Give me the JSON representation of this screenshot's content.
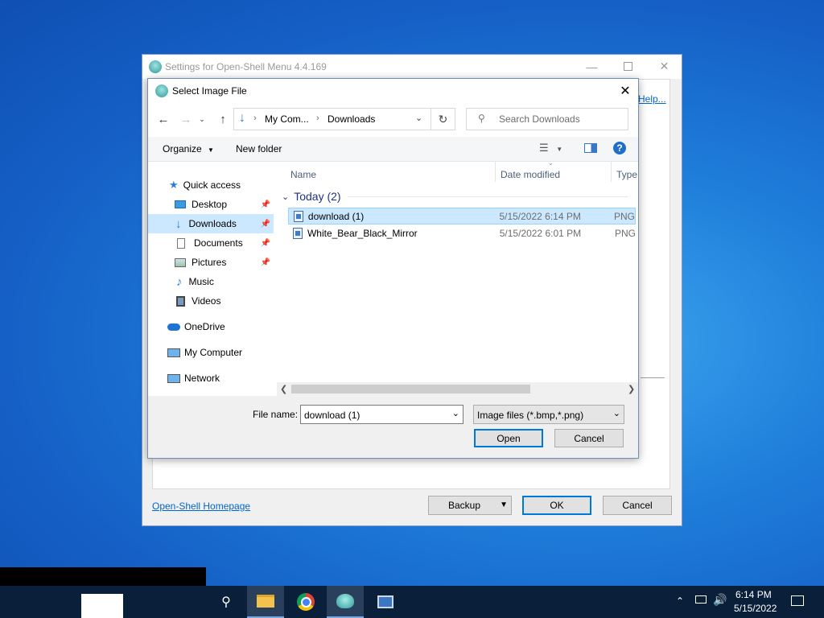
{
  "settings_window": {
    "title": "Settings for Open-Shell Menu 4.4.169",
    "help_link": "Help...",
    "homepage_link": "Open-Shell Homepage",
    "backup_label": "Backup",
    "ok_label": "OK",
    "cancel_label": "Cancel"
  },
  "dialog": {
    "title": "Select Image File",
    "breadcrumb": [
      "My Com...",
      "Downloads"
    ],
    "search_placeholder": "Search Downloads",
    "organize_label": "Organize",
    "new_folder_label": "New folder",
    "nav": {
      "quick_access": "Quick access",
      "desktop": "Desktop",
      "downloads": "Downloads",
      "documents": "Documents",
      "pictures": "Pictures",
      "music": "Music",
      "videos": "Videos",
      "onedrive": "OneDrive",
      "my_computer": "My Computer",
      "network": "Network"
    },
    "columns": {
      "name": "Name",
      "date": "Date modified",
      "type": "Type"
    },
    "group_label": "Today (2)",
    "files": [
      {
        "name": "download (1)",
        "date": "5/15/2022 6:14 PM",
        "type": "PNG"
      },
      {
        "name": "White_Bear_Black_Mirror",
        "date": "5/15/2022 6:01 PM",
        "type": "PNG"
      }
    ],
    "filename_label": "File name:",
    "filename_value": "download (1)",
    "filter_value": "Image files (*.bmp,*.png)",
    "open_label": "Open",
    "cancel_label": "Cancel"
  },
  "taskbar": {
    "time": "6:14 PM",
    "date": "5/15/2022"
  }
}
